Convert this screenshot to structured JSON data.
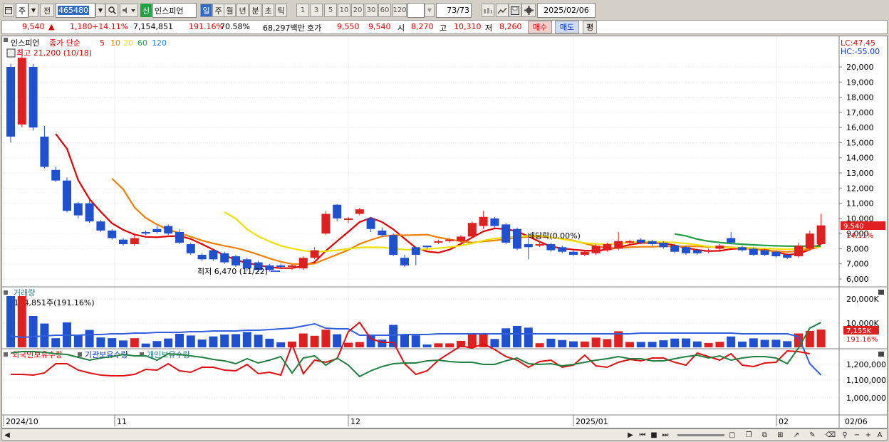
{
  "toolbar": {
    "type": "주",
    "mode": "전",
    "code": "465480",
    "new_badge": "신",
    "stock_name": "인스피언",
    "periods": [
      "일",
      "주",
      "월",
      "년",
      "분",
      "초",
      "틱"
    ],
    "minutes": [
      "1",
      "3",
      "5",
      "10",
      "20",
      "30",
      "60",
      "120"
    ],
    "count": "73",
    "count_total": "/73",
    "date": "2025/02/06"
  },
  "quote": {
    "price": "9,540",
    "arrow": "▲",
    "change": "1,180",
    "change_pct": "+14.11%",
    "volume": "7,154,851",
    "volume_pct": "191.16%",
    "turnover": "70.58%",
    "amount": "68,297백만",
    "hoga_label": "호가",
    "ask": "9,550",
    "bid": "9,540",
    "open_label": "시",
    "open": "8,270",
    "high_label": "고",
    "high": "10,310",
    "low_label": "저",
    "low": "8,260",
    "buy": "매수",
    "sell": "매도",
    "avg": "평"
  },
  "price_panel": {
    "name": "인스피언",
    "ma_label": "종가 단순",
    "periods": [
      "5",
      "10",
      "20",
      "60",
      "120"
    ],
    "lc": "LC:47.45",
    "hc": "HC:-55.00",
    "high_note": "최고 21,200 (10/18)",
    "low_note": "최저 6,470 (11/22)",
    "dividend_note": "배당락(0.00%)",
    "price_tag": "9,540",
    "pct_tag": "14.11%",
    "yticks": [
      "20,000",
      "19,000",
      "18,000",
      "17,000",
      "16,000",
      "15,000",
      "14,000",
      "13,000",
      "12,000",
      "11,000",
      "10,000",
      "9,000",
      "8,000",
      "7,000",
      "6,000"
    ]
  },
  "volume_panel": {
    "title": "거래량",
    "note": "7,154,851주(191.16%)",
    "yticks": [
      "20,000K",
      "10,000K"
    ],
    "vol_tag": "7,155K",
    "vol_pct_tag": "191.16%"
  },
  "holding_panel": {
    "titles": [
      "외국인보유수량",
      "기관보유수량",
      "개인보유수량"
    ],
    "yticks": [
      "1,200,000",
      "1,100,000",
      "1,000,000"
    ]
  },
  "xaxis": {
    "labels": [
      "2024/10",
      "11",
      "12",
      "2025/01",
      "02"
    ],
    "last_date": "02/06"
  },
  "colors": {
    "up": "#e02020",
    "down": "#1e50d0",
    "ma5": "#e00000",
    "ma10": "#f08000",
    "ma20": "#f0e000",
    "ma60": "#20a040",
    "ma120": "#2080ff",
    "foreign": "#3060e0",
    "inst": "#e01010",
    "retail": "#208040"
  },
  "chart_data": {
    "type": "candlestick",
    "dates": [
      "10/14",
      "10/15",
      "10/16",
      "10/17",
      "10/18",
      "10/21",
      "10/22",
      "10/23",
      "10/24",
      "10/25",
      "10/28",
      "10/29",
      "10/30",
      "10/31",
      "11/01",
      "11/04",
      "11/05",
      "11/06",
      "11/07",
      "11/08",
      "11/11",
      "11/12",
      "11/13",
      "11/14",
      "11/15",
      "11/18",
      "11/19",
      "11/20",
      "11/21",
      "11/22",
      "11/25",
      "11/26",
      "11/27",
      "11/28",
      "11/29",
      "12/02",
      "12/03",
      "12/04",
      "12/05",
      "12/06",
      "12/09",
      "12/10",
      "12/11",
      "12/12",
      "12/13",
      "12/16",
      "12/17",
      "12/18",
      "12/19",
      "12/20",
      "12/23",
      "12/24",
      "12/26",
      "12/27",
      "12/30",
      "01/02",
      "01/03",
      "01/06",
      "01/07",
      "01/08",
      "01/09",
      "01/10",
      "01/13",
      "01/14",
      "01/15",
      "01/16",
      "01/17",
      "01/20",
      "01/21",
      "01/22",
      "01/23",
      "01/24",
      "02/06"
    ],
    "open": [
      20000,
      16200,
      20000,
      15400,
      13200,
      12500,
      11000,
      11000,
      9800,
      9200,
      8600,
      8300,
      9100,
      9300,
      9500,
      9100,
      8300,
      7600,
      7900,
      7700,
      7500,
      7300,
      7100,
      6900,
      6900,
      6800,
      6700,
      7400,
      9000,
      10900,
      9900,
      10300,
      10000,
      9200,
      8900,
      7400,
      8100,
      8200,
      8400,
      8500,
      8500,
      8800,
      9500,
      10000,
      9600,
      9300,
      8300,
      8200,
      8300,
      8100,
      7800,
      7600,
      7700,
      7900,
      8000,
      8400,
      8600,
      8500,
      8400,
      8200,
      8100,
      7900,
      7800,
      8000,
      8700,
      8100,
      8000,
      7900,
      7800,
      7600,
      7500,
      8000,
      8300
    ],
    "close": [
      15400,
      20600,
      16000,
      13400,
      12500,
      10500,
      10200,
      9800,
      9200,
      8700,
      8300,
      8700,
      9000,
      9100,
      9000,
      8400,
      7700,
      7300,
      7300,
      7100,
      6900,
      6700,
      6600,
      6600,
      6800,
      6900,
      7400,
      7900,
      10300,
      10000,
      10000,
      10600,
      9300,
      8900,
      7600,
      6900,
      7600,
      8100,
      8500,
      8600,
      8800,
      9700,
      10100,
      9500,
      8400,
      8000,
      8100,
      8300,
      7900,
      7800,
      7600,
      7800,
      8200,
      8300,
      8500,
      8500,
      8400,
      8300,
      8100,
      7800,
      7700,
      7700,
      7900,
      8200,
      8400,
      7900,
      7600,
      7600,
      7500,
      7400,
      8200,
      9000,
      9540
    ],
    "high": [
      20200,
      21200,
      20200,
      16100,
      13400,
      12700,
      11100,
      11200,
      9900,
      9300,
      8700,
      8900,
      9200,
      9500,
      9600,
      9300,
      8400,
      7700,
      7900,
      7800,
      7600,
      7400,
      7200,
      7000,
      7000,
      6950,
      7500,
      8100,
      10500,
      10950,
      10100,
      10700,
      10100,
      9400,
      9000,
      7600,
      7700,
      8200,
      8600,
      8700,
      8900,
      9800,
      10500,
      10100,
      9700,
      9400,
      8700,
      8400,
      8400,
      8200,
      7900,
      7900,
      8300,
      8400,
      9100,
      8600,
      8700,
      8600,
      8500,
      8300,
      8200,
      8000,
      8000,
      8300,
      9100,
      8200,
      8100,
      8000,
      7900,
      7700,
      8400,
      9200,
      10310
    ],
    "low": [
      15000,
      16000,
      15800,
      13300,
      12400,
      10400,
      10000,
      9700,
      9100,
      8600,
      8200,
      8200,
      8900,
      9000,
      8900,
      8300,
      7600,
      7200,
      7200,
      7000,
      6800,
      6500,
      6470,
      6500,
      6700,
      6600,
      6600,
      7300,
      8900,
      9800,
      9700,
      10200,
      9100,
      8800,
      7500,
      6800,
      6900,
      8000,
      8300,
      8400,
      8400,
      8700,
      9300,
      9400,
      8300,
      7900,
      7300,
      8100,
      7800,
      7700,
      7500,
      7500,
      7600,
      7800,
      7900,
      8200,
      8300,
      8200,
      8000,
      7700,
      7600,
      7600,
      7700,
      7900,
      8300,
      7800,
      7500,
      7500,
      7400,
      7300,
      7400,
      7900,
      8260
    ]
  }
}
